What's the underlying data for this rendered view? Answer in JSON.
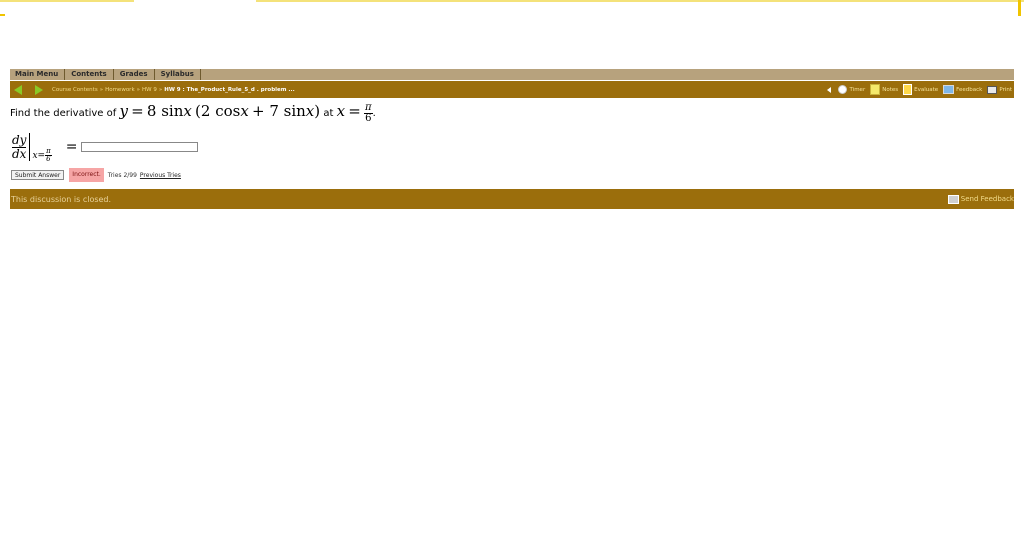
{
  "menu": {
    "items": [
      "Main Menu",
      "Contents",
      "Grades",
      "Syllabus"
    ]
  },
  "nav": {
    "breadcrumbs": [
      "Course Contents",
      "Homework",
      "HW 9",
      "HW 9 : The_Product_Rule_5_d . problem ..."
    ],
    "separator": "»",
    "tools": {
      "timer": "Timer",
      "notes": "Notes",
      "evaluate": "Evaluate",
      "feedback": "Feedback",
      "print": "Print"
    }
  },
  "problem": {
    "prefix": "Find the derivative of",
    "y_var": "y",
    "equals": "=",
    "expr_a": "8 sin",
    "x1": "x",
    "expr_b": "(2 cos",
    "x2": "x",
    "plus": "+ 7 sin",
    "x3": "x",
    "close": ")",
    "at": "at",
    "x_var": "x",
    "pi": "π",
    "six": "6",
    "period": "."
  },
  "derivative": {
    "numerator": "dy",
    "denominator": "dx",
    "sub_x": "x",
    "sub_eq": "=",
    "sub_pi": "π",
    "sub_six": "6",
    "equals": "=",
    "answer_value": ""
  },
  "actions": {
    "submit_label": "Submit Answer",
    "status": "Incorrect.",
    "tries": "Tries 2/99",
    "previous_tries": "Previous Tries"
  },
  "discussion": {
    "text": "This discussion is closed.",
    "send_feedback": "Send Feedback"
  }
}
